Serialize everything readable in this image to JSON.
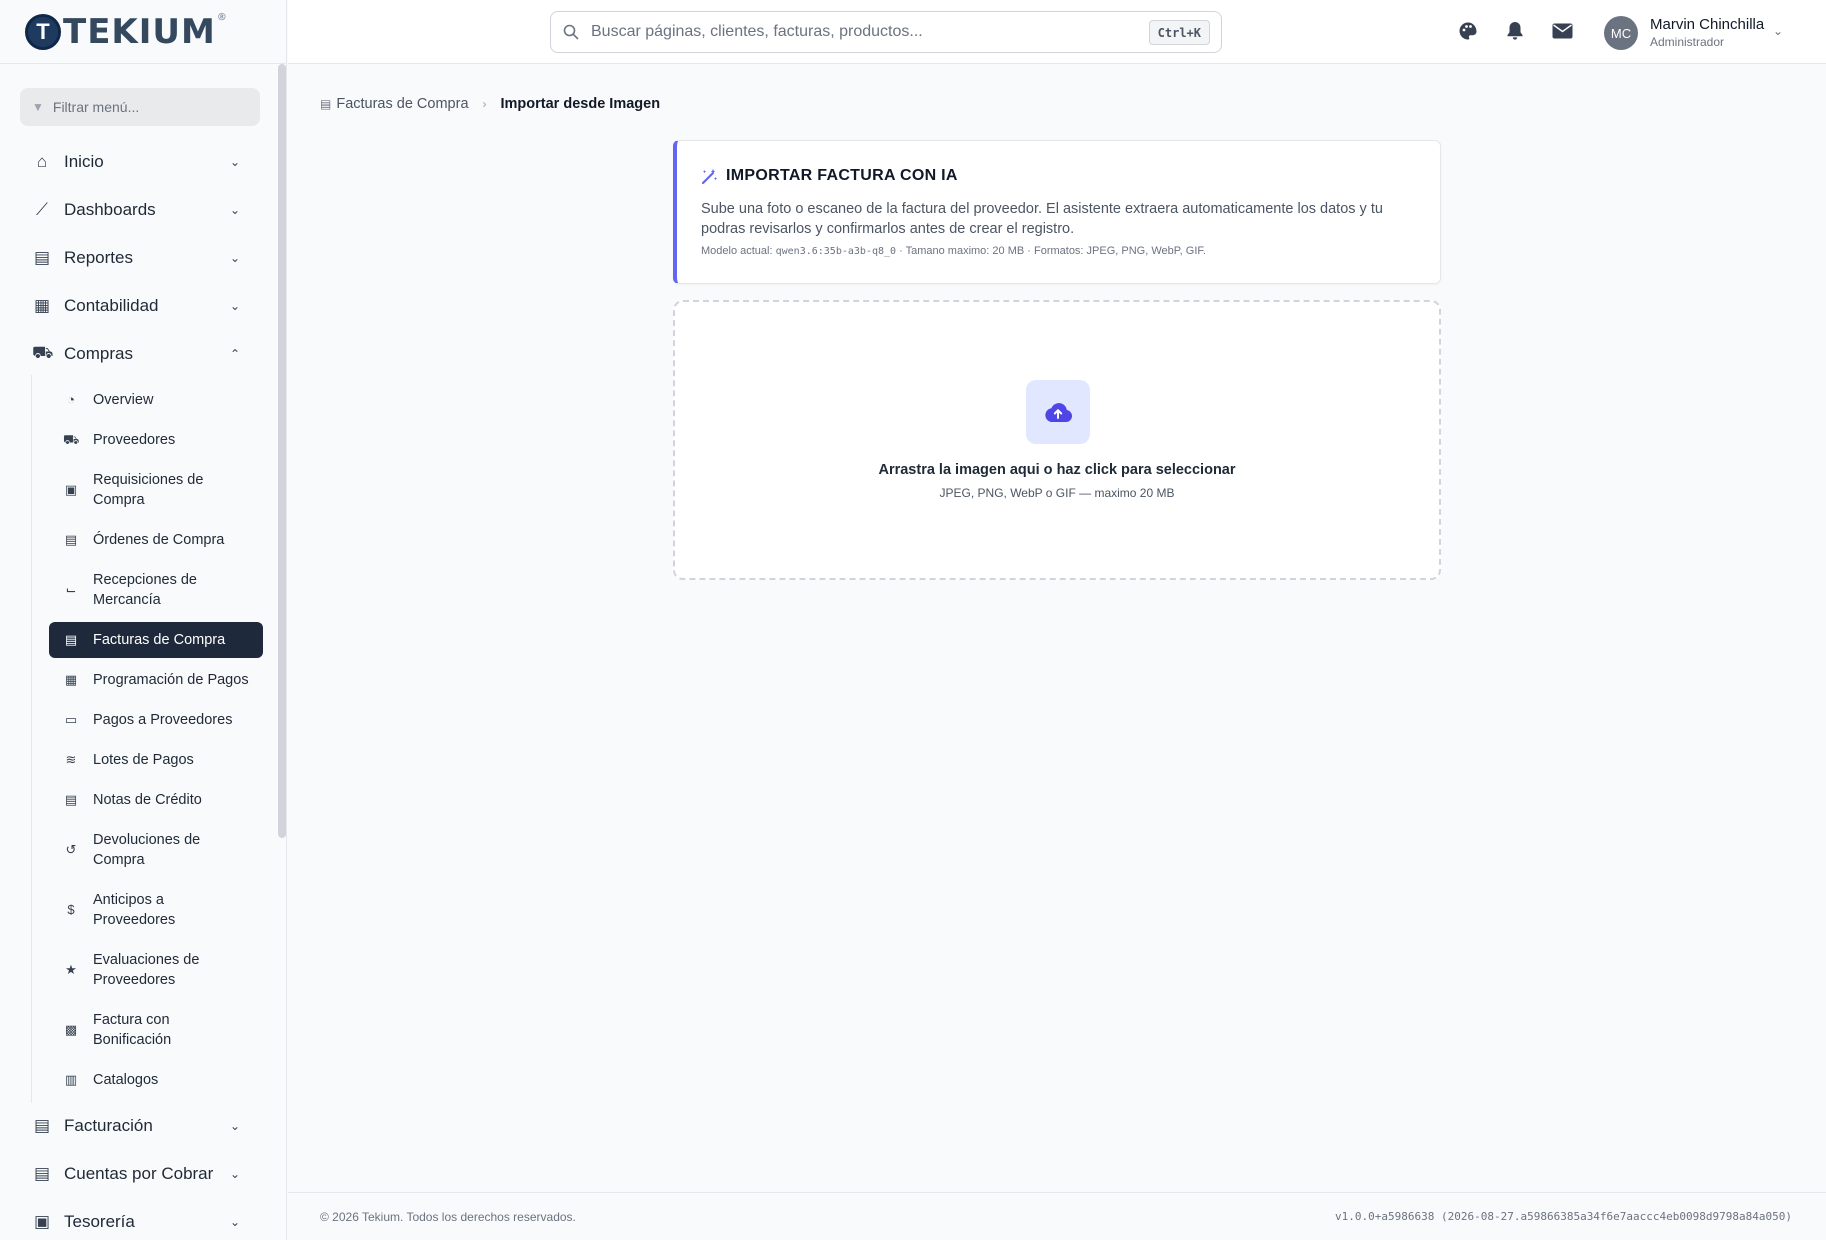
{
  "brand": {
    "name": "TEKIUM",
    "mark": "T",
    "reg": "®"
  },
  "sidebar": {
    "filter_placeholder": "Filtrar menú...",
    "top_items": [
      {
        "label": "Inicio",
        "icon": "home-icon"
      },
      {
        "label": "Dashboards",
        "icon": "chart-line-icon"
      },
      {
        "label": "Reportes",
        "icon": "document-icon"
      },
      {
        "label": "Contabilidad",
        "icon": "calculator-icon"
      },
      {
        "label": "Compras",
        "icon": "cart-icon",
        "expanded": true
      }
    ],
    "sub_items": [
      {
        "label": "Overview",
        "icon": "gauge-icon"
      },
      {
        "label": "Proveedores",
        "icon": "truck-icon"
      },
      {
        "label": "Requisiciones de Compra",
        "icon": "clipboard-icon"
      },
      {
        "label": "Órdenes de Compra",
        "icon": "file-icon"
      },
      {
        "label": "Recepciones de Mercancía",
        "icon": "dolly-icon"
      },
      {
        "label": "Facturas de Compra",
        "icon": "invoice-icon",
        "active": true
      },
      {
        "label": "Programación de Pagos",
        "icon": "calendar-check-icon"
      },
      {
        "label": "Pagos a Proveedores",
        "icon": "money-card-icon"
      },
      {
        "label": "Lotes de Pagos",
        "icon": "layers-icon"
      },
      {
        "label": "Notas de Crédito",
        "icon": "note-icon"
      },
      {
        "label": "Devoluciones de Compra",
        "icon": "undo-icon"
      },
      {
        "label": "Anticipos a Proveedores",
        "icon": "hand-dollar-icon"
      },
      {
        "label": "Evaluaciones de Proveedores",
        "icon": "star-icon"
      },
      {
        "label": "Factura con Bonificación",
        "icon": "gift-icon"
      },
      {
        "label": "Catalogos",
        "icon": "book-icon"
      }
    ],
    "bottom_items": [
      {
        "label": "Facturación",
        "icon": "invoice-dollar-icon"
      },
      {
        "label": "Cuentas por Cobrar",
        "icon": "receivable-icon"
      },
      {
        "label": "Tesorería",
        "icon": "money-bill-icon"
      }
    ]
  },
  "header": {
    "search_placeholder": "Buscar páginas, clientes, facturas, productos...",
    "shortcut": "Ctrl+K",
    "user": {
      "initials": "MC",
      "name": "Marvin Chinchilla",
      "role": "Administrador"
    }
  },
  "breadcrumb": {
    "parent": "Facturas de Compra",
    "current": "Importar desde Imagen"
  },
  "card": {
    "title": "IMPORTAR FACTURA CON IA",
    "description": "Sube una foto o escaneo de la factura del proveedor. El asistente extraera automaticamente los datos y tu podras revisarlos y confirmarlos antes de crear el registro.",
    "meta_prefix": "Modelo actual: ",
    "model": "qwen3.6:35b-a3b-q8_0",
    "meta_suffix": " · Tamano maximo: 20 MB · Formatos: JPEG, PNG, WebP, GIF."
  },
  "dropzone": {
    "title": "Arrastra la imagen aqui o haz click para seleccionar",
    "subtitle": "JPEG, PNG, WebP o GIF — maximo 20 MB"
  },
  "footer": {
    "copyright": "© 2026 Tekium. Todos los derechos reservados.",
    "version": "v1.0.0+a5986638 (2026-08-27.a59866385a34f6e7aaccc4eb0098d9798a84a050)"
  },
  "colors": {
    "accent": "#6366f1",
    "active_nav": "#1e293b",
    "drop_icon_bg": "#e0e7ff"
  }
}
